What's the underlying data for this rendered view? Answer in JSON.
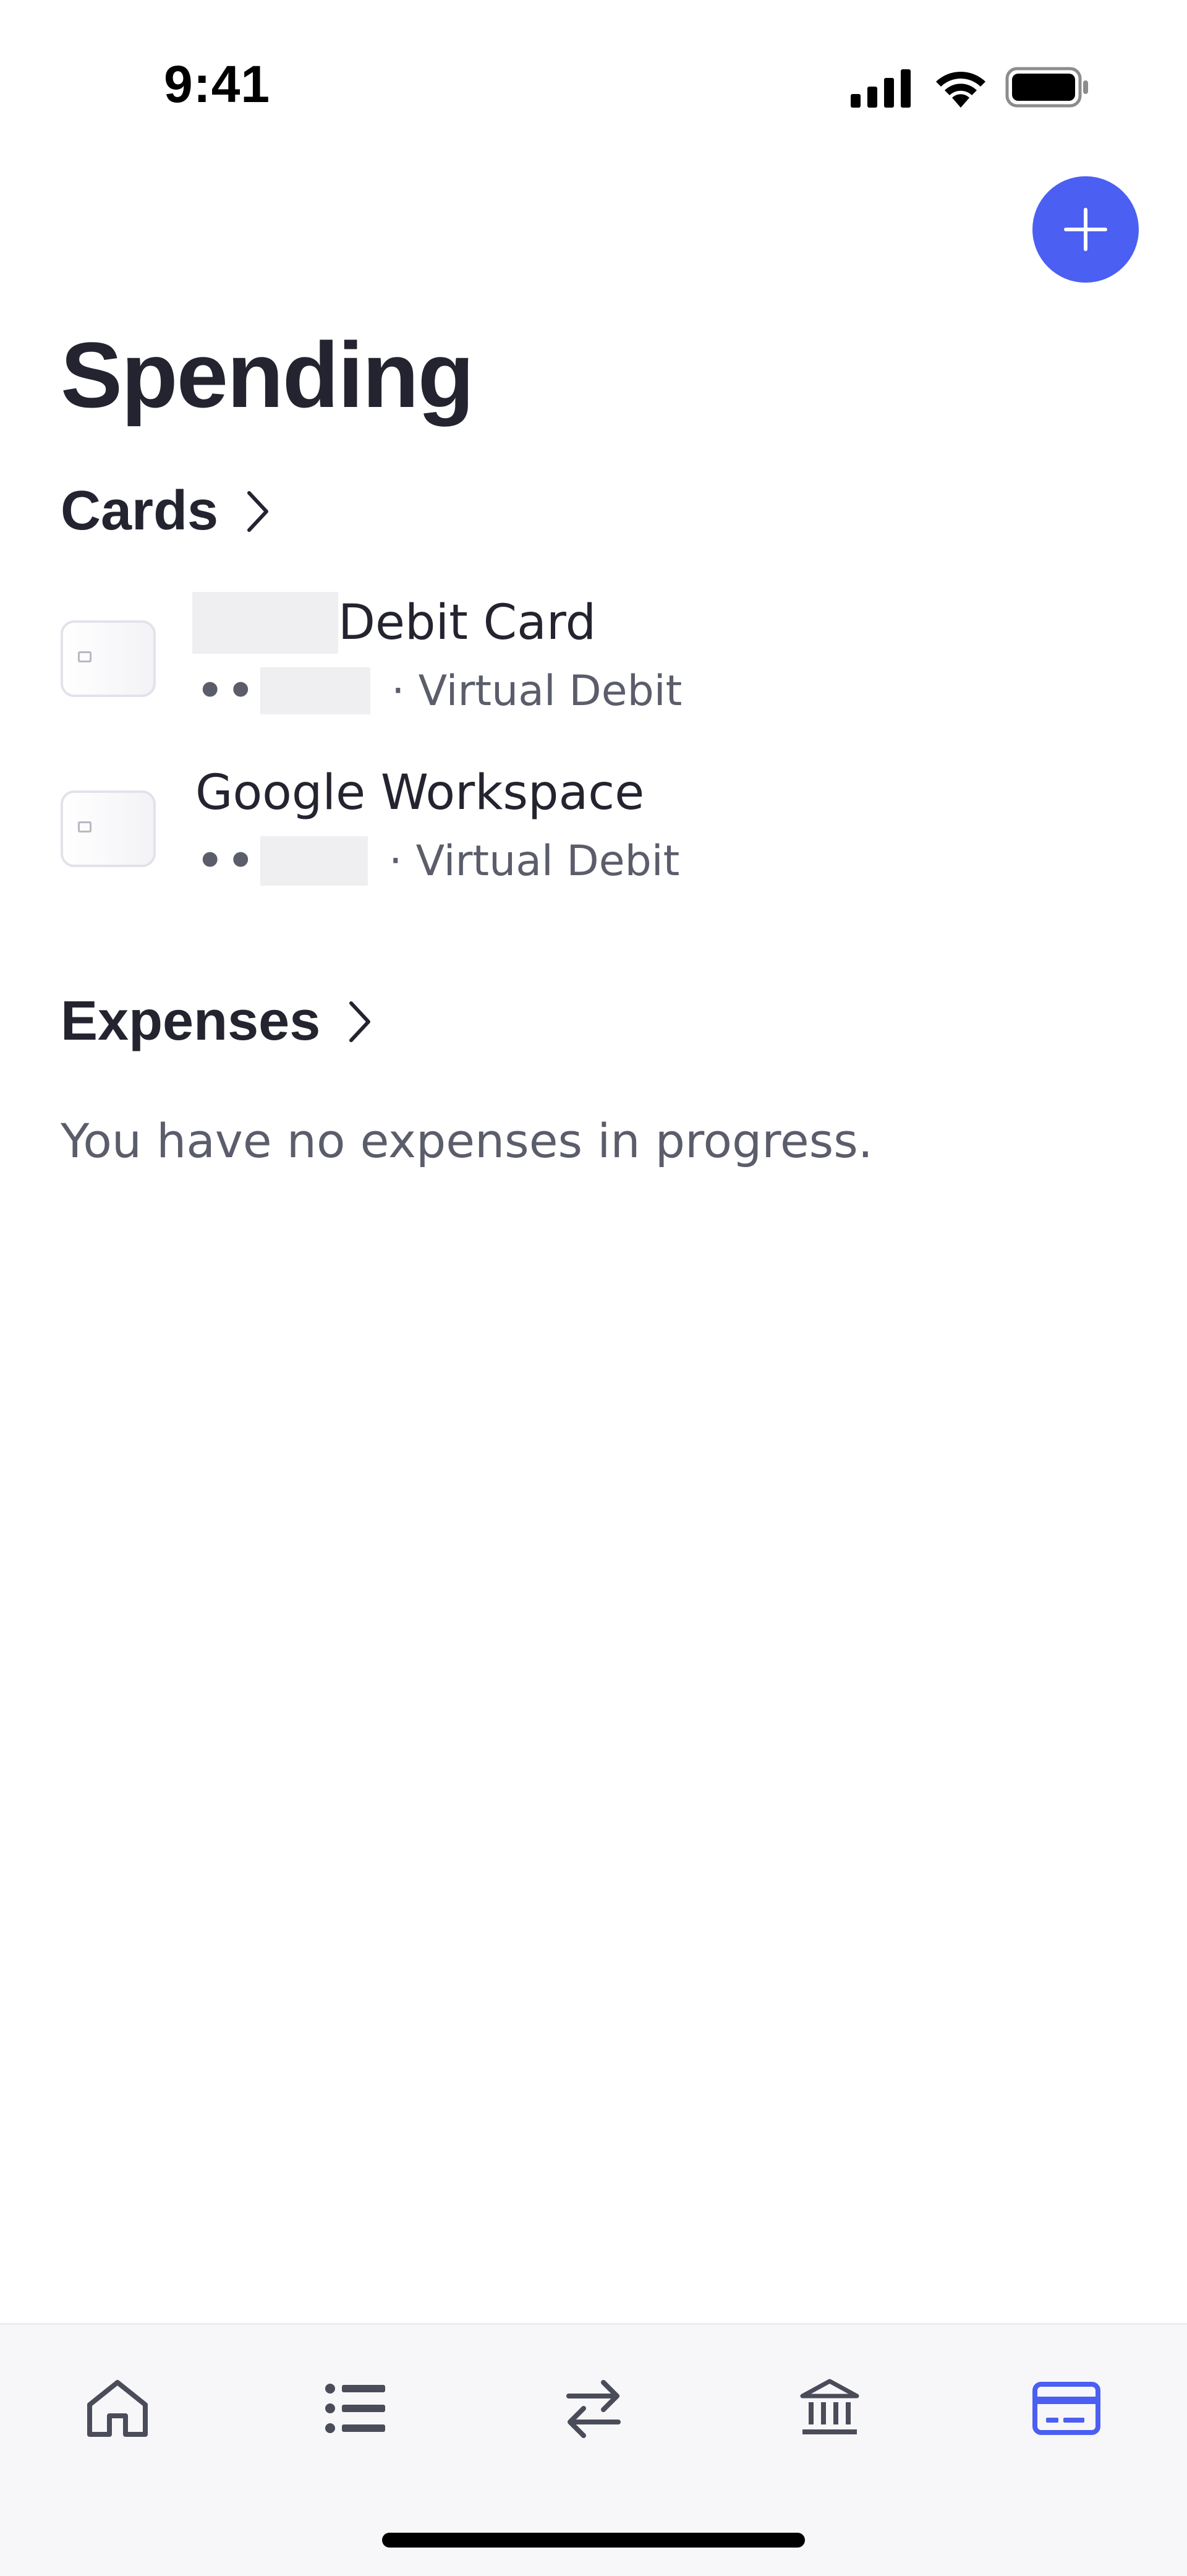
{
  "status_bar": {
    "time": "9:41"
  },
  "header": {
    "title": "Spending",
    "add_button_icon": "plus-icon"
  },
  "cards_section": {
    "title": "Cards",
    "items": [
      {
        "name": "Debit Card",
        "dots": "••",
        "type": "Virtual Debit"
      },
      {
        "name": "Google Workspace",
        "dots": "••",
        "type": "Virtual Debit"
      }
    ]
  },
  "expenses_section": {
    "title": "Expenses",
    "empty_message": "You have no expenses in progress."
  },
  "tab_bar": {
    "tabs": [
      {
        "icon": "home-icon",
        "active": false
      },
      {
        "icon": "list-icon",
        "active": false
      },
      {
        "icon": "transfer-icon",
        "active": false
      },
      {
        "icon": "bank-icon",
        "active": false
      },
      {
        "icon": "card-icon",
        "active": true
      }
    ]
  },
  "colors": {
    "accent": "#4b5ff2",
    "text": "#23242f",
    "muted": "#5b5d6b",
    "icon": "#4a4c5a"
  }
}
